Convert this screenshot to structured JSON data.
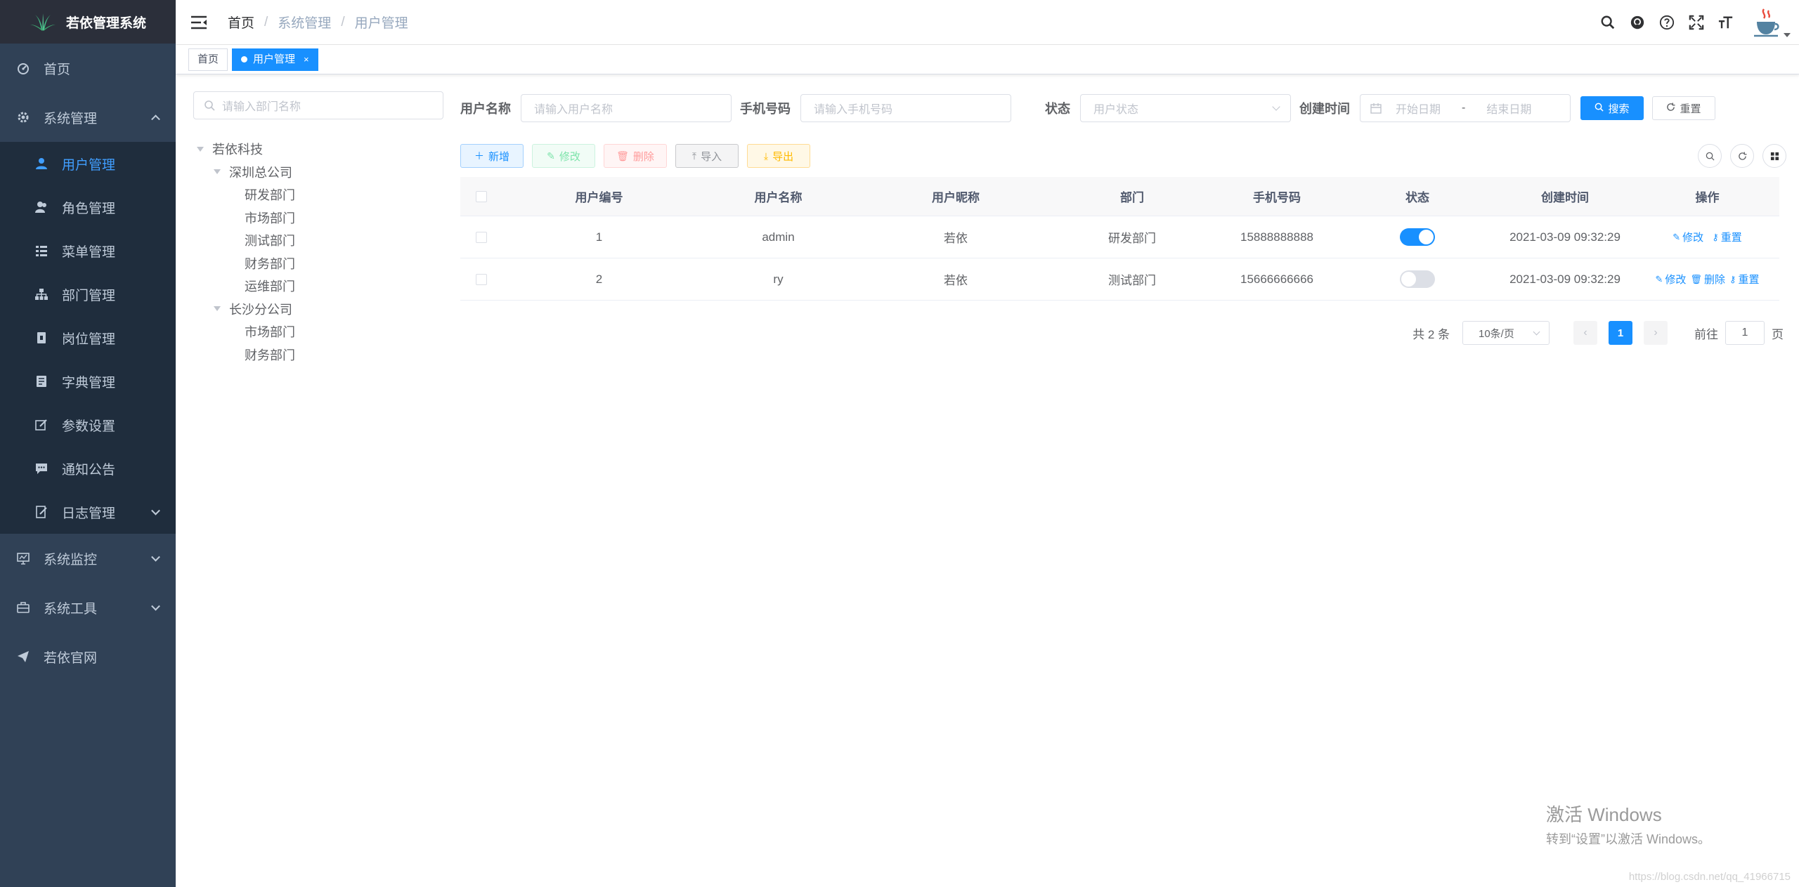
{
  "sidebar": {
    "app_title": "若依管理系统",
    "items": [
      {
        "label": "首页",
        "icon": "dashboard-icon"
      },
      {
        "label": "系统管理",
        "icon": "gear-icon",
        "expanded": true
      },
      {
        "label": "系统监控",
        "icon": "monitor-icon"
      },
      {
        "label": "系统工具",
        "icon": "toolbox-icon"
      },
      {
        "label": "若依官网",
        "icon": "send-icon"
      }
    ],
    "sub_items": [
      {
        "label": "用户管理",
        "icon": "user-icon",
        "active": true
      },
      {
        "label": "角色管理",
        "icon": "peoples-icon"
      },
      {
        "label": "菜单管理",
        "icon": "tree-table-icon"
      },
      {
        "label": "部门管理",
        "icon": "tree-icon"
      },
      {
        "label": "岗位管理",
        "icon": "post-icon"
      },
      {
        "label": "字典管理",
        "icon": "dict-icon"
      },
      {
        "label": "参数设置",
        "icon": "edit-icon"
      },
      {
        "label": "通知公告",
        "icon": "message-icon"
      },
      {
        "label": "日志管理",
        "icon": "log-icon"
      }
    ]
  },
  "navbar": {
    "breadcrumb": [
      "首页",
      "系统管理",
      "用户管理"
    ],
    "separator": "/"
  },
  "tags": [
    {
      "label": "首页",
      "active": false
    },
    {
      "label": "用户管理",
      "active": true,
      "close": "×"
    }
  ],
  "dept_tree": {
    "search_placeholder": "请输入部门名称",
    "nodes": [
      {
        "label": "若依科技",
        "level": 0,
        "expanded": true
      },
      {
        "label": "深圳总公司",
        "level": 1,
        "expanded": true
      },
      {
        "label": "研发部门",
        "level": 2
      },
      {
        "label": "市场部门",
        "level": 2
      },
      {
        "label": "测试部门",
        "level": 2
      },
      {
        "label": "财务部门",
        "level": 2
      },
      {
        "label": "运维部门",
        "level": 2
      },
      {
        "label": "长沙分公司",
        "level": 1,
        "expanded": true
      },
      {
        "label": "市场部门",
        "level": 2
      },
      {
        "label": "财务部门",
        "level": 2
      }
    ]
  },
  "search_form": {
    "username_label": "用户名称",
    "username_placeholder": "请输入用户名称",
    "phone_label": "手机号码",
    "phone_placeholder": "请输入手机号码",
    "status_label": "状态",
    "status_placeholder": "用户状态",
    "created_label": "创建时间",
    "start_placeholder": "开始日期",
    "range_sep": "-",
    "end_placeholder": "结束日期",
    "search_button": "搜索",
    "reset_button": "重置"
  },
  "toolbar": {
    "add": "新增",
    "edit": "修改",
    "delete": "删除",
    "import": "导入",
    "export": "导出"
  },
  "table": {
    "columns": [
      "用户编号",
      "用户名称",
      "用户昵称",
      "部门",
      "手机号码",
      "状态",
      "创建时间",
      "操作"
    ],
    "rows": [
      {
        "id": "1",
        "username": "admin",
        "nickname": "若依",
        "dept": "研发部门",
        "phone": "15888888888",
        "status_on": true,
        "created": "2021-03-09 09:32:29",
        "ops": [
          "修改",
          "重置"
        ]
      },
      {
        "id": "2",
        "username": "ry",
        "nickname": "若依",
        "dept": "测试部门",
        "phone": "15666666666",
        "status_on": false,
        "created": "2021-03-09 09:32:29",
        "ops": [
          "修改",
          "删除",
          "重置"
        ]
      }
    ]
  },
  "pagination": {
    "total_text": "共 2 条",
    "page_size": "10条/页",
    "current_page": "1",
    "goto_prefix": "前往",
    "goto_value": "1",
    "goto_suffix": "页"
  },
  "watermark": {
    "line1": "激活 Windows",
    "line2": "转到“设置”以激活 Windows。"
  },
  "footer_url": "https://blog.csdn.net/qq_41966715",
  "colors": {
    "sidebar_bg": "#304156",
    "submenu_bg": "#1f2d3d",
    "primary": "#1890ff",
    "active_menu": "#409eff"
  }
}
